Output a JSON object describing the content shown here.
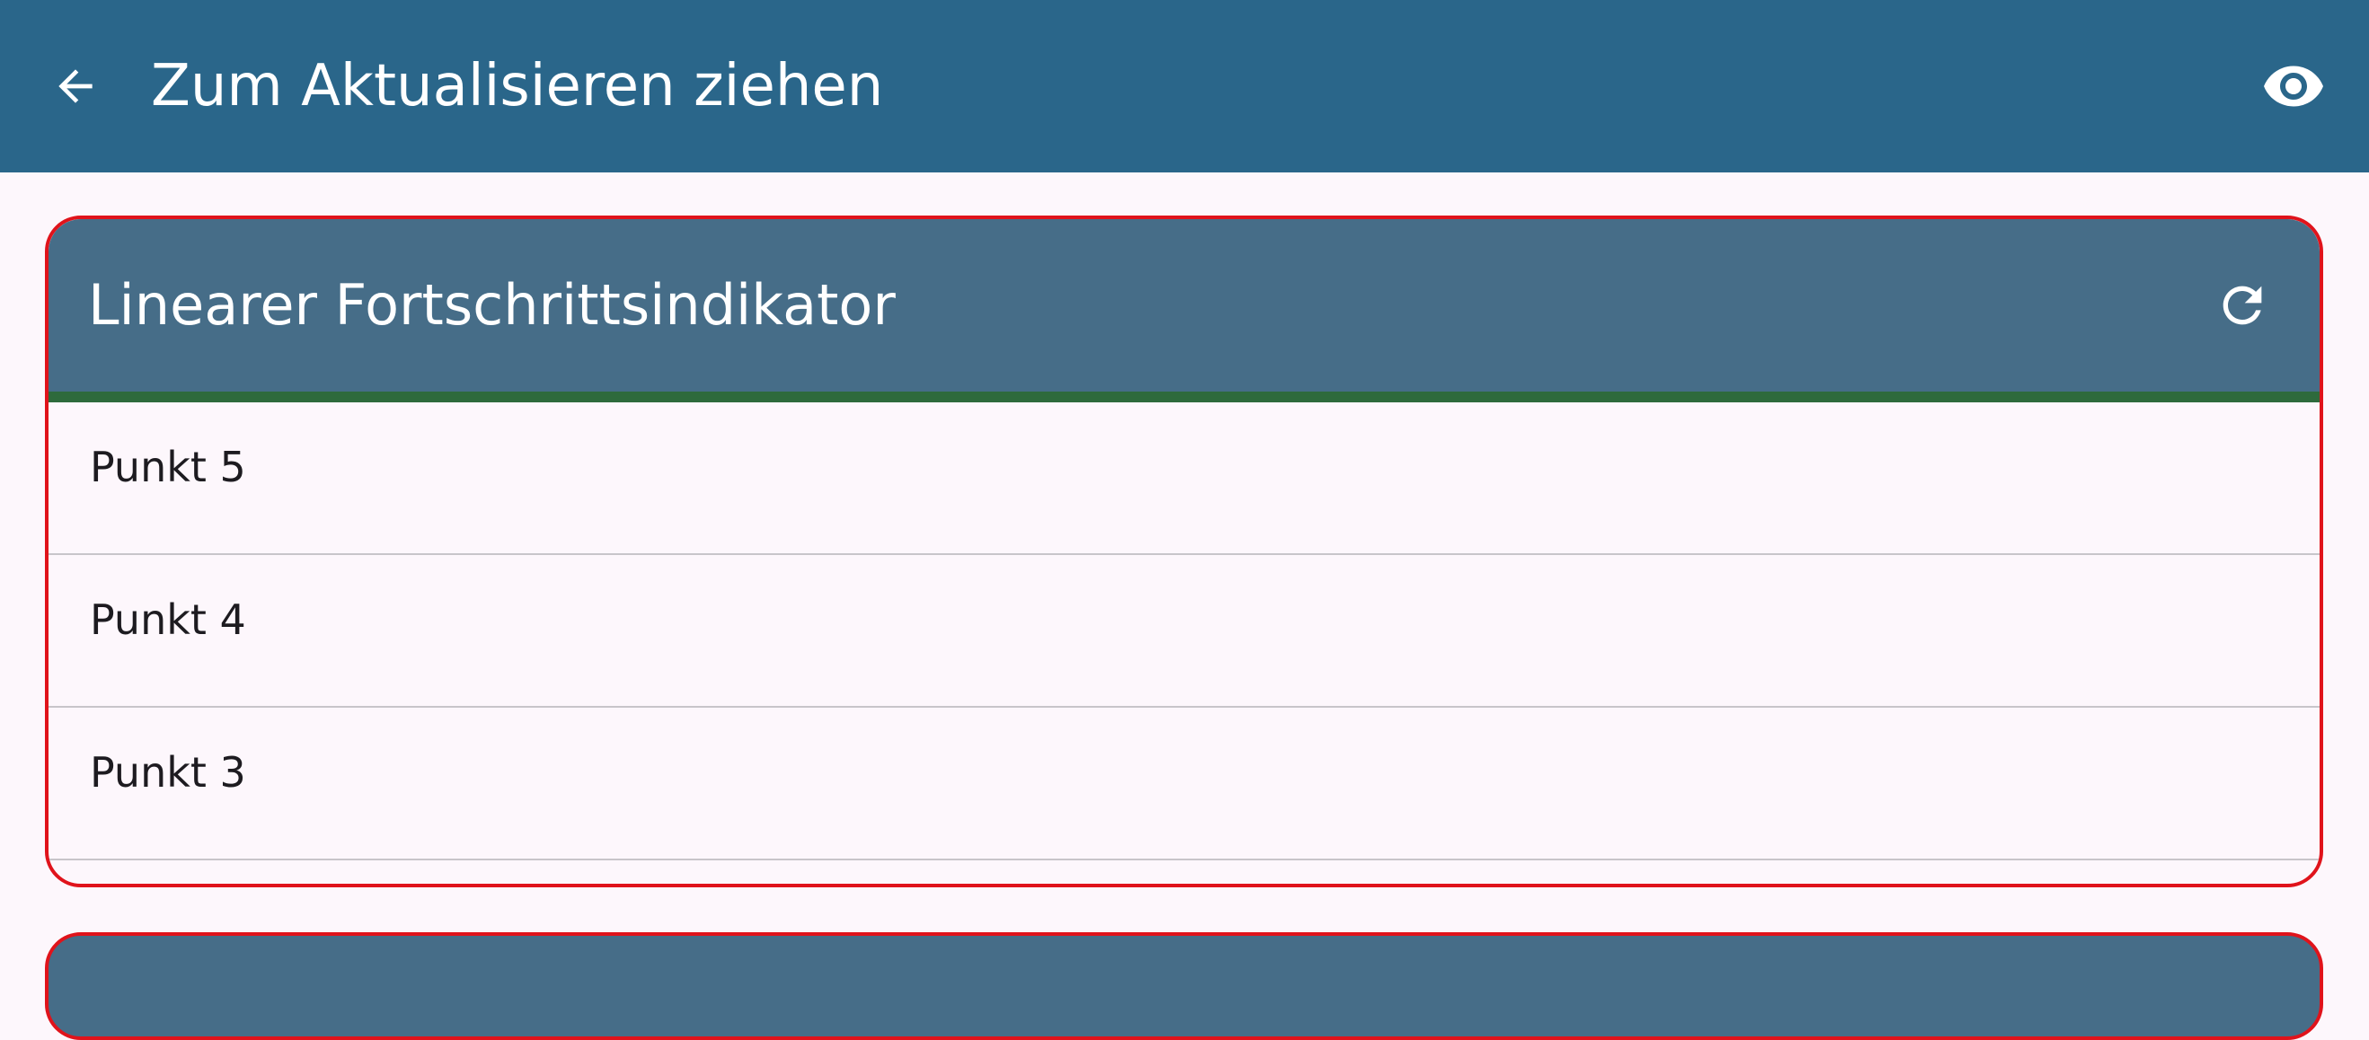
{
  "colors": {
    "appbar": "#2A668A",
    "card_header": "#466D88",
    "progress": "#2E6A3C",
    "card_border": "#E0131B",
    "background": "#FDF7FC"
  },
  "appbar": {
    "title": "Zum Aktualisieren ziehen",
    "back_icon": "arrow-back-icon",
    "visibility_icon": "eye-icon"
  },
  "card": {
    "title": "Linearer Fortschrittsindikator",
    "refresh_icon": "refresh-icon",
    "progress_fraction": 1.0,
    "items": [
      {
        "label": "Punkt 5"
      },
      {
        "label": "Punkt 4"
      },
      {
        "label": "Punkt 3"
      }
    ]
  }
}
